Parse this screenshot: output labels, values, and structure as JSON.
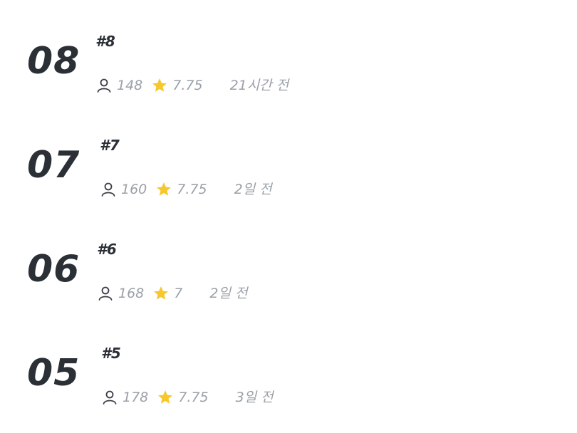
{
  "episodes": [
    {
      "number": "08",
      "title": "#8",
      "views": "148",
      "rating": "7.75",
      "time": "21시간 전"
    },
    {
      "number": "07",
      "title": "#7",
      "views": "160",
      "rating": "7.75",
      "time": "2일 전"
    },
    {
      "number": "06",
      "title": "#6",
      "views": "168",
      "rating": "7",
      "time": "2일 전"
    },
    {
      "number": "05",
      "title": "#5",
      "views": "178",
      "rating": "7.75",
      "time": "3일 전"
    }
  ],
  "icons": {
    "views": "person-icon",
    "rating": "star-icon"
  },
  "colors": {
    "number_text": "#2b2f36",
    "meta_text": "#9aa0a8",
    "star": "#f7c82e"
  }
}
